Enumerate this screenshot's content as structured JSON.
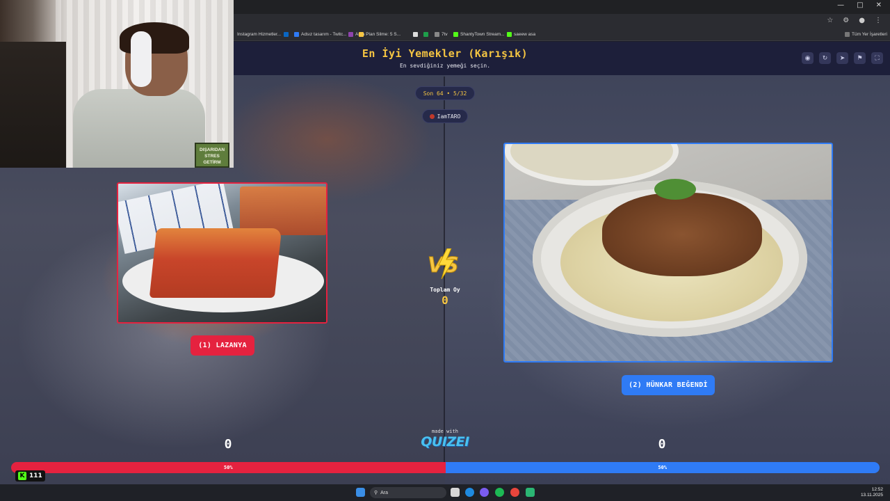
{
  "browser": {
    "bookmarks": [
      {
        "label": "Instagram Hizmetler...",
        "color": "#c13584"
      },
      {
        "label": "Adsız tasarım - Twitc...",
        "color": "#2f7bf5"
      },
      {
        "label": "Arka Plan Silme: 5 S...",
        "color": "#8e44ad"
      },
      {
        "label": "",
        "color": "#f5c542"
      },
      {
        "label": "7tv",
        "color": "#888888"
      },
      {
        "label": "ShantyTown Stream...",
        "color": "#53fc18"
      },
      {
        "label": "saeew asa",
        "color": "#53fc18"
      }
    ],
    "all_bookmarks_label": "Tüm Yer İşaretleri"
  },
  "header": {
    "title": "En İyi Yemekler (Karışık)",
    "subtitle": "En sevdiğiniz yemeği seçin."
  },
  "round": {
    "label": "Son 64 • 5/32"
  },
  "user": {
    "name": "IamTARO"
  },
  "left": {
    "button_label": "(1) LAZANYA",
    "count": "0",
    "percent_label": "50%",
    "percent": 50,
    "accent": "#e5223f"
  },
  "right": {
    "button_label": "(2) HÜNKAR BEĞENDİ",
    "count": "0",
    "percent_label": "50%",
    "percent": 50,
    "accent": "#2f7bf5"
  },
  "center": {
    "total_label": "Toplam Oy",
    "total_value": "0",
    "made_with": "made with",
    "brand": "QUIZEI"
  },
  "overlay": {
    "kick_count": "111",
    "webcam_sign": "DIŞARIDAN STRES GETİRM"
  },
  "taskbar": {
    "search_placeholder": "Ara",
    "time": "12:52",
    "date": "13.11.2025"
  },
  "colors": {
    "title": "#f5c542",
    "header_bg": "#1d1f3a"
  }
}
